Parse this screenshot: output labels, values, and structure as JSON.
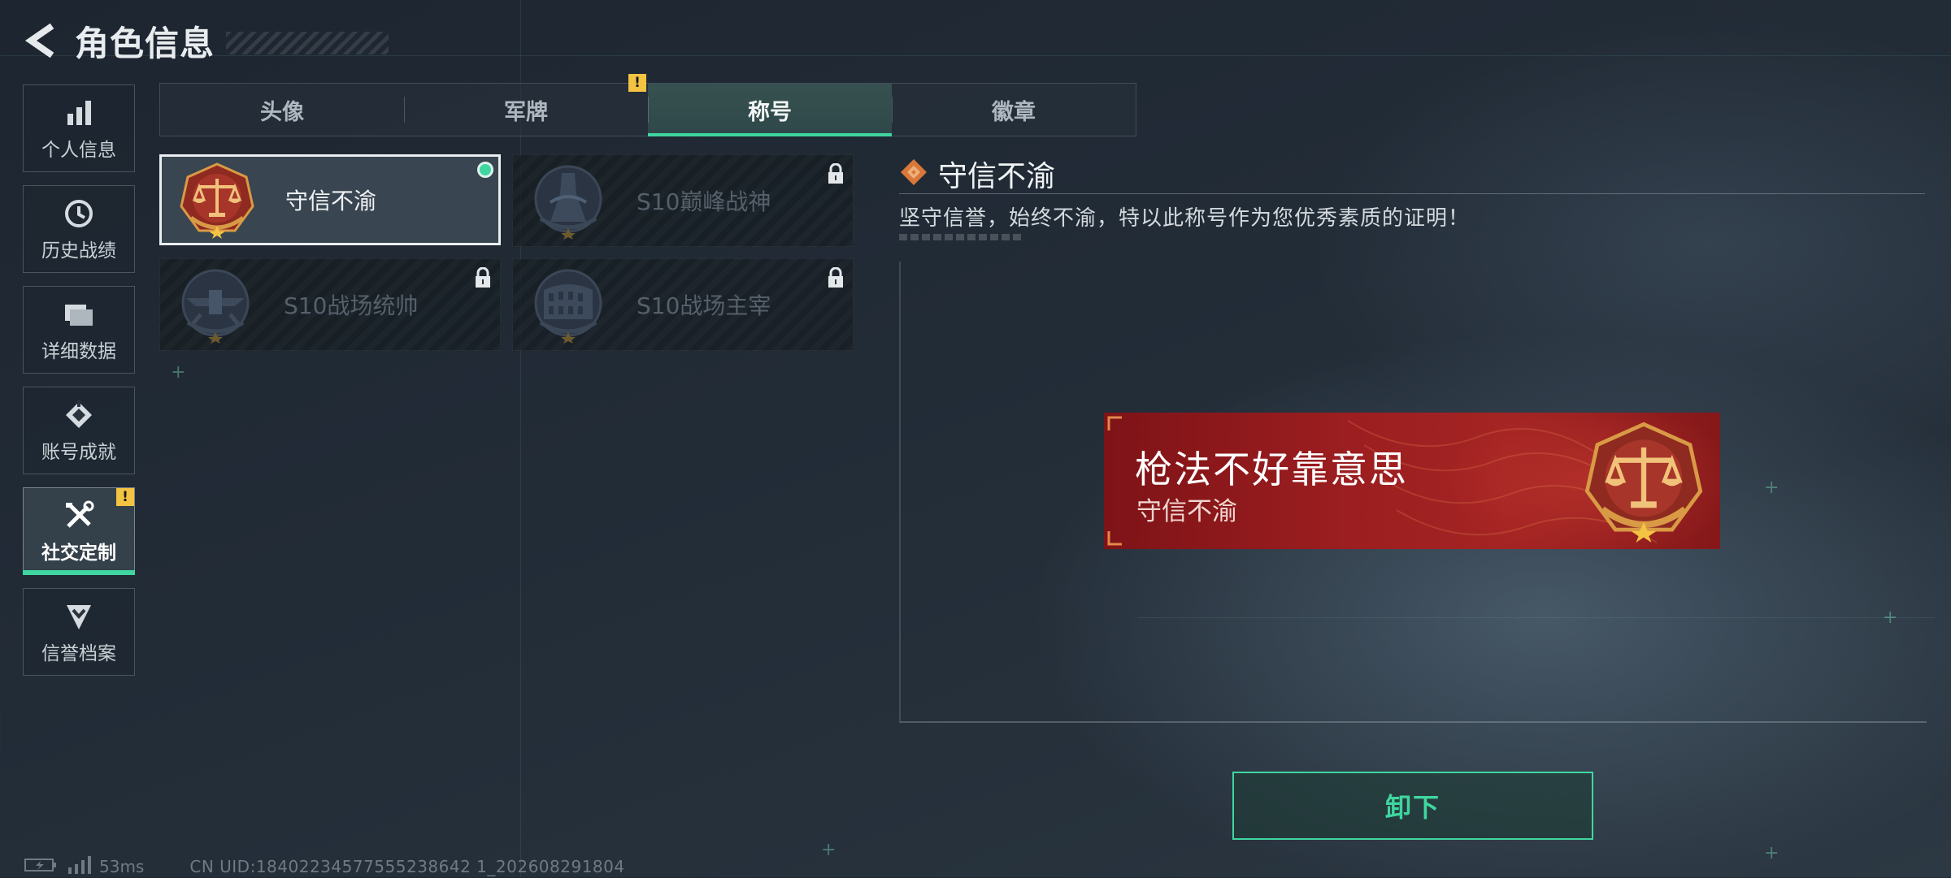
{
  "header": {
    "title": "角色信息"
  },
  "sidebar": {
    "items": [
      {
        "label": "个人信息",
        "icon": "bar-chart-icon",
        "active": false,
        "alert": false
      },
      {
        "label": "历史战绩",
        "icon": "history-icon",
        "active": false,
        "alert": false
      },
      {
        "label": "详细数据",
        "icon": "folder-icon",
        "active": false,
        "alert": false
      },
      {
        "label": "账号成就",
        "icon": "achievement-icon",
        "active": false,
        "alert": false
      },
      {
        "label": "社交定制",
        "icon": "tools-icon",
        "active": true,
        "alert": true
      },
      {
        "label": "信誉档案",
        "icon": "shield-chevron-icon",
        "active": false,
        "alert": false
      }
    ],
    "alert_text": "!"
  },
  "tabs": [
    {
      "label": "头像",
      "active": false,
      "alert": false
    },
    {
      "label": "军牌",
      "active": false,
      "alert": true
    },
    {
      "label": "称号",
      "active": true,
      "alert": false
    },
    {
      "label": "徽章",
      "active": false,
      "alert": false
    }
  ],
  "titles": [
    {
      "name": "守信不渝",
      "emblem": "scales-emblem",
      "selected": true,
      "equipped": true,
      "locked": false
    },
    {
      "name": "S10巅峰战神",
      "emblem": "tower-emblem",
      "selected": false,
      "equipped": false,
      "locked": true
    },
    {
      "name": "S10战场统帅",
      "emblem": "aircraft-emblem",
      "selected": false,
      "equipped": false,
      "locked": true
    },
    {
      "name": "S10战场主宰",
      "emblem": "colosseum-emblem",
      "selected": false,
      "equipped": false,
      "locked": true
    }
  ],
  "detail": {
    "name": "守信不渝",
    "description": "坚守信誉，始终不渝，特以此称号作为您优秀素质的证明！"
  },
  "preview_banner": {
    "main_text": "枪法不好靠意思",
    "sub_text": "守信不渝"
  },
  "actions": {
    "unequip_label": "卸下"
  },
  "status": {
    "ping": "53ms",
    "uid": "CN UID:18402234577555238642 1_202608291804"
  },
  "colors": {
    "accent": "#3fd6a0",
    "alert": "#f3c342",
    "banner_red": "#9c1e20",
    "emblem_gold": "#d99a45"
  }
}
